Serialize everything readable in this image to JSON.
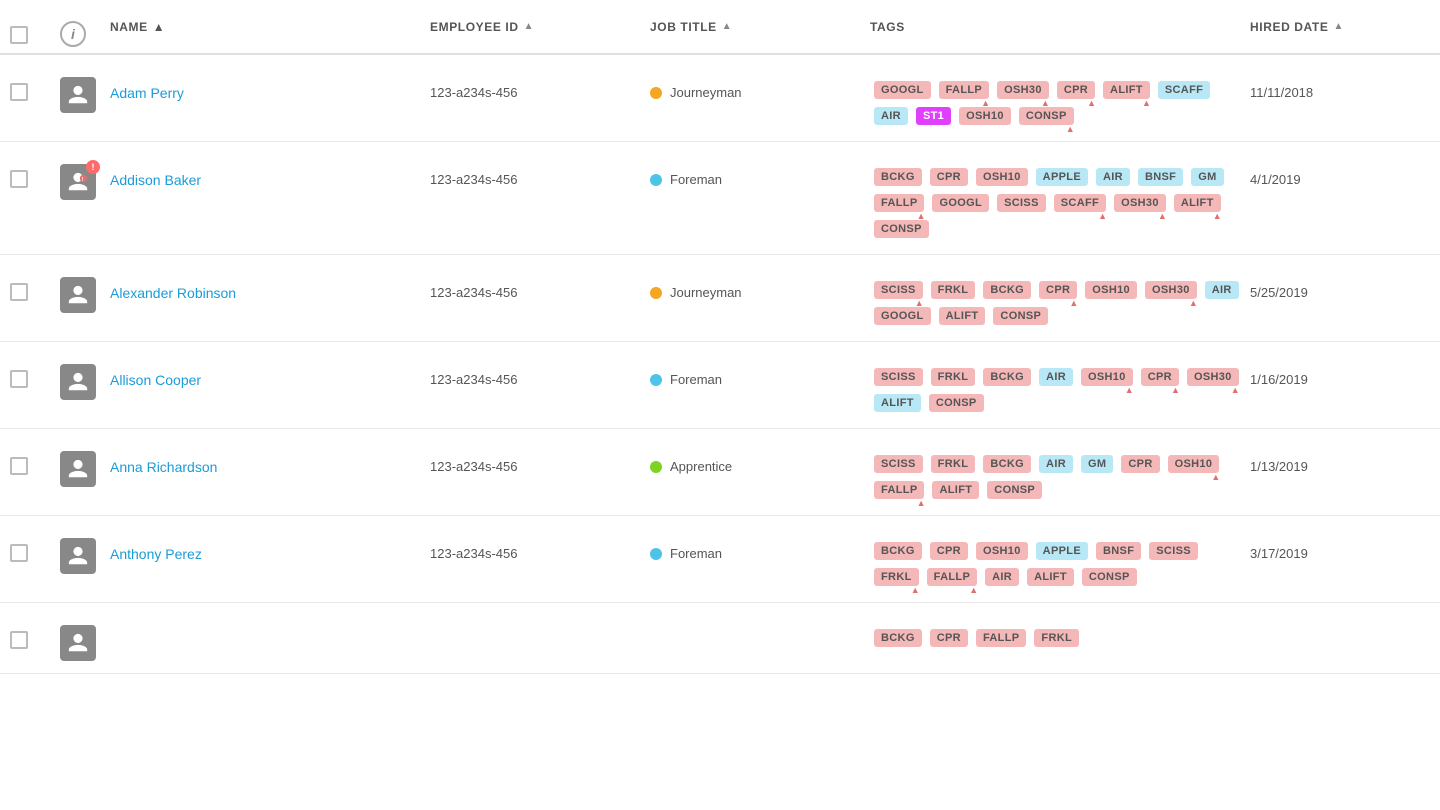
{
  "header": {
    "columns": [
      {
        "id": "check",
        "label": ""
      },
      {
        "id": "info",
        "label": ""
      },
      {
        "id": "name",
        "label": "NAME",
        "sortable": true,
        "sorted": "asc"
      },
      {
        "id": "empid",
        "label": "EMPLOYEE ID",
        "sortable": true
      },
      {
        "id": "jobtitle",
        "label": "JOB TITLE",
        "sortable": true
      },
      {
        "id": "tags",
        "label": "TAGS",
        "sortable": false
      },
      {
        "id": "hireddate",
        "label": "HIRED DATE",
        "sortable": true
      }
    ]
  },
  "rows": [
    {
      "id": "adam-perry",
      "name": "Adam Perry",
      "employee_id": "123-a234s-456",
      "job_title": "Journeyman",
      "job_dot": "yellow",
      "hired_date": "11/11/2018",
      "avatar_warning": false,
      "tags": [
        {
          "label": "GOOGL",
          "type": "pink",
          "warn": false
        },
        {
          "label": "FALLP",
          "type": "pink",
          "warn": true
        },
        {
          "label": "OSH30",
          "type": "pink",
          "warn": true
        },
        {
          "label": "CPR",
          "type": "pink",
          "warn": true
        },
        {
          "label": "ALIFT",
          "type": "pink",
          "warn": true
        },
        {
          "label": "SCAFF",
          "type": "blue",
          "warn": false
        },
        {
          "label": "AIR",
          "type": "blue",
          "warn": false
        },
        {
          "label": "ST1",
          "type": "magenta",
          "warn": false
        },
        {
          "label": "OSH10",
          "type": "pink",
          "warn": false
        },
        {
          "label": "CONSP",
          "type": "pink",
          "warn": true
        }
      ]
    },
    {
      "id": "addison-baker",
      "name": "Addison Baker",
      "employee_id": "123-a234s-456",
      "job_title": "Foreman",
      "job_dot": "blue",
      "hired_date": "4/1/2019",
      "avatar_warning": true,
      "tags": [
        {
          "label": "BCKG",
          "type": "pink",
          "warn": false
        },
        {
          "label": "CPR",
          "type": "pink",
          "warn": false
        },
        {
          "label": "OSH10",
          "type": "pink",
          "warn": false
        },
        {
          "label": "APPLE",
          "type": "blue",
          "warn": false
        },
        {
          "label": "AIR",
          "type": "blue",
          "warn": false
        },
        {
          "label": "BNSF",
          "type": "blue",
          "warn": false
        },
        {
          "label": "GM",
          "type": "blue",
          "warn": false
        },
        {
          "label": "FALLP",
          "type": "pink",
          "warn": true
        },
        {
          "label": "GOOGL",
          "type": "pink",
          "warn": false
        },
        {
          "label": "SCISS",
          "type": "pink",
          "warn": false
        },
        {
          "label": "SCAFF",
          "type": "pink",
          "warn": true
        },
        {
          "label": "OSH30",
          "type": "pink",
          "warn": true
        },
        {
          "label": "ALIFT",
          "type": "pink",
          "warn": true
        },
        {
          "label": "CONSP",
          "type": "pink",
          "warn": false
        }
      ]
    },
    {
      "id": "alexander-robinson",
      "name": "Alexander Robinson",
      "employee_id": "123-a234s-456",
      "job_title": "Journeyman",
      "job_dot": "yellow",
      "hired_date": "5/25/2019",
      "avatar_warning": false,
      "tags": [
        {
          "label": "SCISS",
          "type": "pink",
          "warn": true
        },
        {
          "label": "FRKL",
          "type": "pink",
          "warn": false
        },
        {
          "label": "BCKG",
          "type": "pink",
          "warn": false
        },
        {
          "label": "CPR",
          "type": "pink",
          "warn": true
        },
        {
          "label": "OSH10",
          "type": "pink",
          "warn": false
        },
        {
          "label": "OSH30",
          "type": "pink",
          "warn": true
        },
        {
          "label": "AIR",
          "type": "blue",
          "warn": false
        },
        {
          "label": "GOOGL",
          "type": "pink",
          "warn": false
        },
        {
          "label": "ALIFT",
          "type": "pink",
          "warn": false
        },
        {
          "label": "CONSP",
          "type": "pink",
          "warn": false
        }
      ]
    },
    {
      "id": "allison-cooper",
      "name": "Allison Cooper",
      "employee_id": "123-a234s-456",
      "job_title": "Foreman",
      "job_dot": "blue",
      "hired_date": "1/16/2019",
      "avatar_warning": false,
      "tags": [
        {
          "label": "SCISS",
          "type": "pink",
          "warn": false
        },
        {
          "label": "FRKL",
          "type": "pink",
          "warn": false
        },
        {
          "label": "BCKG",
          "type": "pink",
          "warn": false
        },
        {
          "label": "AIR",
          "type": "blue",
          "warn": false
        },
        {
          "label": "OSH10",
          "type": "pink",
          "warn": true
        },
        {
          "label": "CPR",
          "type": "pink",
          "warn": true
        },
        {
          "label": "OSH30",
          "type": "pink",
          "warn": true
        },
        {
          "label": "ALIFT",
          "type": "blue",
          "warn": false
        },
        {
          "label": "CONSP",
          "type": "pink",
          "warn": false
        }
      ]
    },
    {
      "id": "anna-richardson",
      "name": "Anna Richardson",
      "employee_id": "123-a234s-456",
      "job_title": "Apprentice",
      "job_dot": "green",
      "hired_date": "1/13/2019",
      "avatar_warning": false,
      "tags": [
        {
          "label": "SCISS",
          "type": "pink",
          "warn": false
        },
        {
          "label": "FRKL",
          "type": "pink",
          "warn": false
        },
        {
          "label": "BCKG",
          "type": "pink",
          "warn": false
        },
        {
          "label": "AIR",
          "type": "blue",
          "warn": false
        },
        {
          "label": "GM",
          "type": "blue",
          "warn": false
        },
        {
          "label": "CPR",
          "type": "pink",
          "warn": false
        },
        {
          "label": "OSH10",
          "type": "pink",
          "warn": true
        },
        {
          "label": "FALLP",
          "type": "pink",
          "warn": true
        },
        {
          "label": "ALIFT",
          "type": "pink",
          "warn": false
        },
        {
          "label": "CONSP",
          "type": "pink",
          "warn": false
        }
      ]
    },
    {
      "id": "anthony-perez",
      "name": "Anthony Perez",
      "employee_id": "123-a234s-456",
      "job_title": "Foreman",
      "job_dot": "blue",
      "hired_date": "3/17/2019",
      "avatar_warning": false,
      "tags": [
        {
          "label": "BCKG",
          "type": "pink",
          "warn": false
        },
        {
          "label": "CPR",
          "type": "pink",
          "warn": false
        },
        {
          "label": "OSH10",
          "type": "pink",
          "warn": false
        },
        {
          "label": "APPLE",
          "type": "blue",
          "warn": false
        },
        {
          "label": "BNSF",
          "type": "pink",
          "warn": false
        },
        {
          "label": "SCISS",
          "type": "pink",
          "warn": false
        },
        {
          "label": "FRKL",
          "type": "pink",
          "warn": true
        },
        {
          "label": "FALLP",
          "type": "pink",
          "warn": true
        },
        {
          "label": "AIR",
          "type": "pink",
          "warn": false
        },
        {
          "label": "ALIFT",
          "type": "pink",
          "warn": false
        },
        {
          "label": "CONSP",
          "type": "pink",
          "warn": false
        }
      ]
    },
    {
      "id": "row-7-partial",
      "name": "",
      "employee_id": "",
      "job_title": "",
      "job_dot": "blue",
      "hired_date": "",
      "avatar_warning": false,
      "tags": [
        {
          "label": "BCKG",
          "type": "pink",
          "warn": false
        },
        {
          "label": "CPR",
          "type": "pink",
          "warn": false
        },
        {
          "label": "FALLP",
          "type": "pink",
          "warn": false
        },
        {
          "label": "FRKL",
          "type": "pink",
          "warn": false
        }
      ]
    }
  ]
}
